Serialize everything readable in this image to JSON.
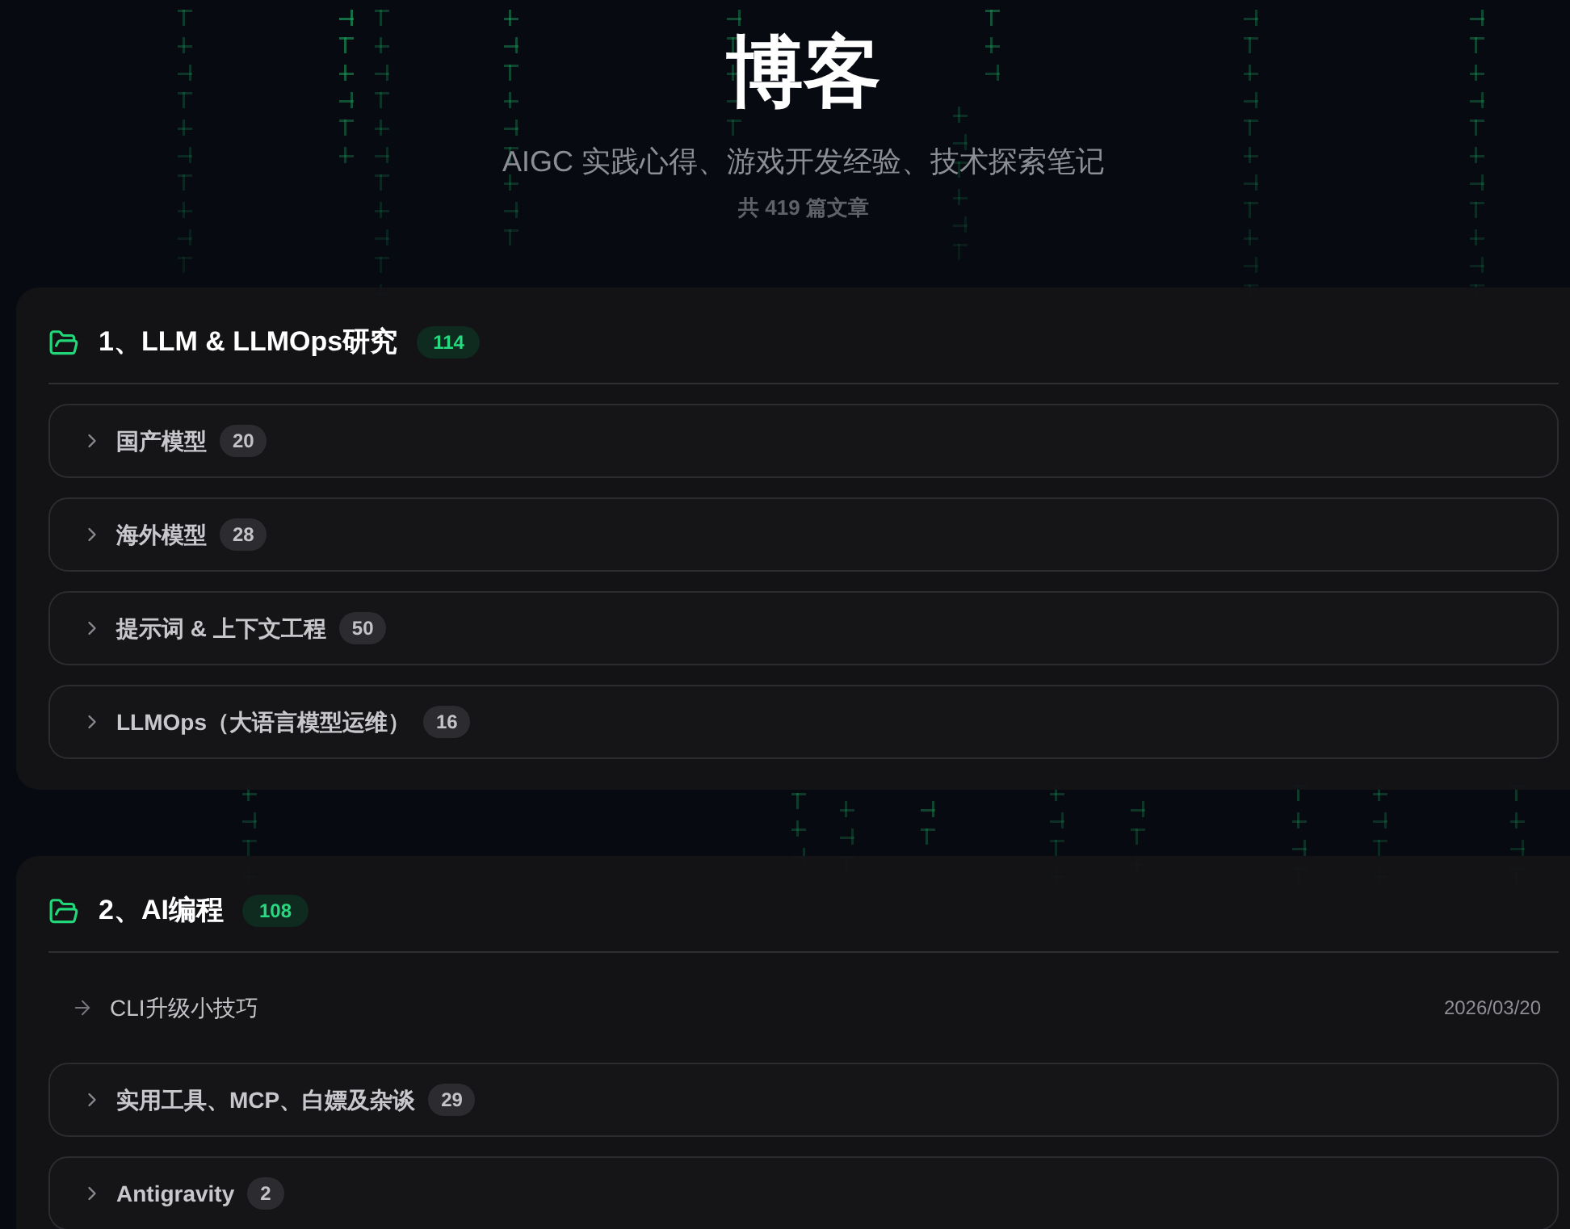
{
  "header": {
    "title": "博客",
    "subtitle": "AIGC 实践心得、游戏开发经验、技术探索笔记",
    "article_count": "共 419 篇文章"
  },
  "sections": [
    {
      "title": "1、LLM & LLMOps研究",
      "count": "114",
      "items": [
        {
          "kind": "category",
          "title": "国产模型",
          "count": "20",
          "expanded": false
        },
        {
          "kind": "category",
          "title": "海外模型",
          "count": "28",
          "expanded": false
        },
        {
          "kind": "category",
          "title": "提示词 & 上下文工程",
          "count": "50",
          "expanded": false
        },
        {
          "kind": "category",
          "title": "LLMOps（大语言模型运维）",
          "count": "16",
          "expanded": false
        }
      ]
    },
    {
      "title": "2、AI编程",
      "count": "108",
      "items": [
        {
          "kind": "article",
          "title": "CLI升级小技巧",
          "date": "2026/03/20"
        },
        {
          "kind": "category",
          "title": "实用工具、MCP、白嫖及杂谈",
          "count": "29",
          "expanded": false
        },
        {
          "kind": "category",
          "title": "Antigravity",
          "count": "2",
          "expanded": false
        }
      ]
    }
  ]
}
